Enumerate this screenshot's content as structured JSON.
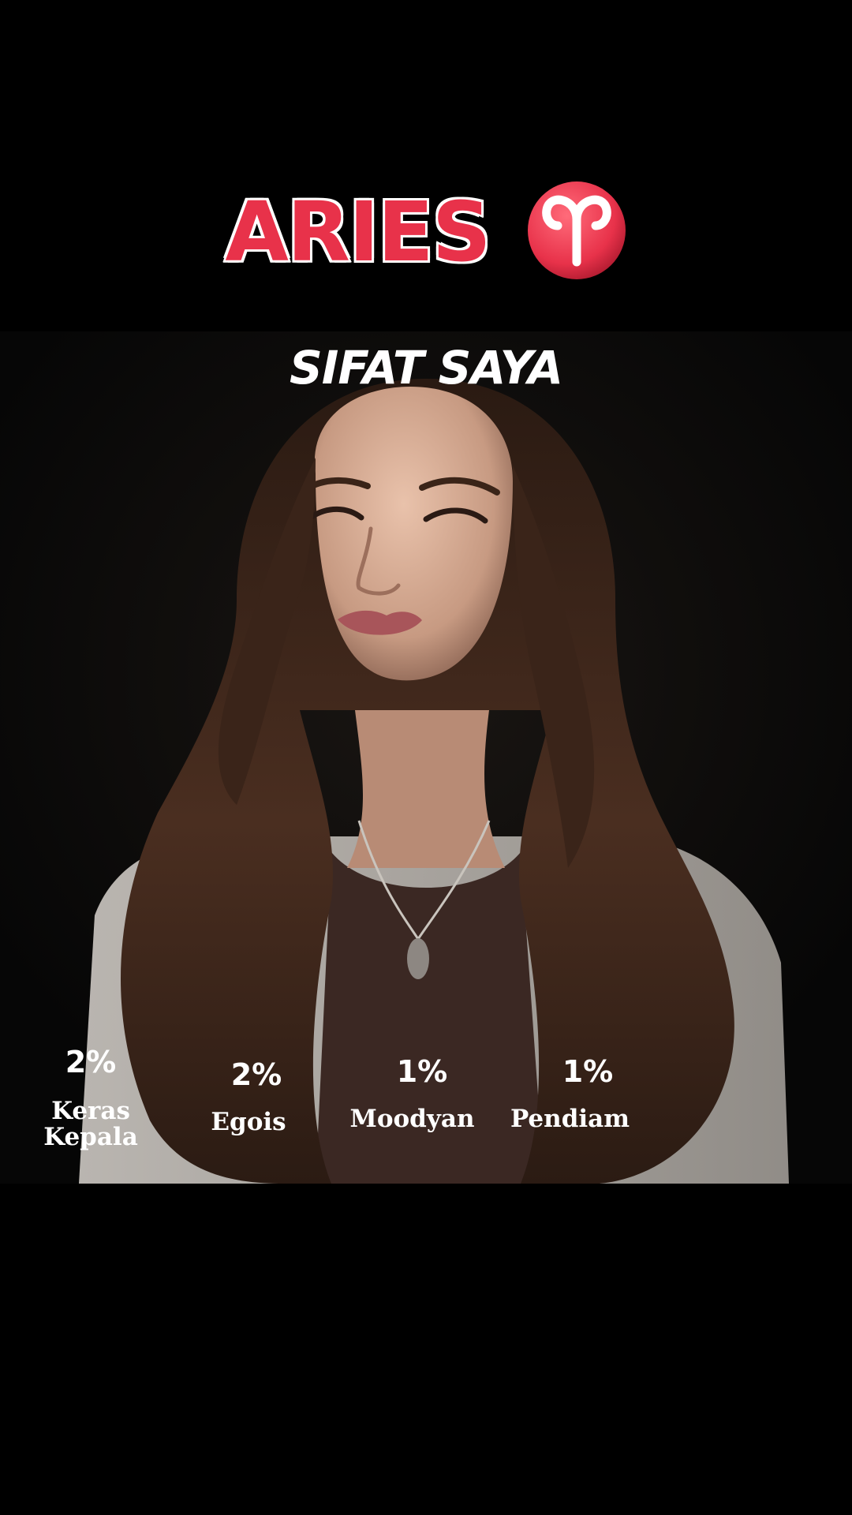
{
  "title": {
    "text": "ARIES",
    "color": "#e8324a",
    "outline": "# ffffff",
    "badge_icon": "aries-zodiac-icon",
    "badge_color": "#e8324a"
  },
  "photo": {
    "subtitle": "SIFAT SAYA"
  },
  "traits": [
    {
      "percent": "2%",
      "label": "Keras Kepala"
    },
    {
      "percent": "2%",
      "label": "Egois"
    },
    {
      "percent": "1%",
      "label": "Moodyan"
    },
    {
      "percent": "1%",
      "label": "Pendiam"
    }
  ]
}
